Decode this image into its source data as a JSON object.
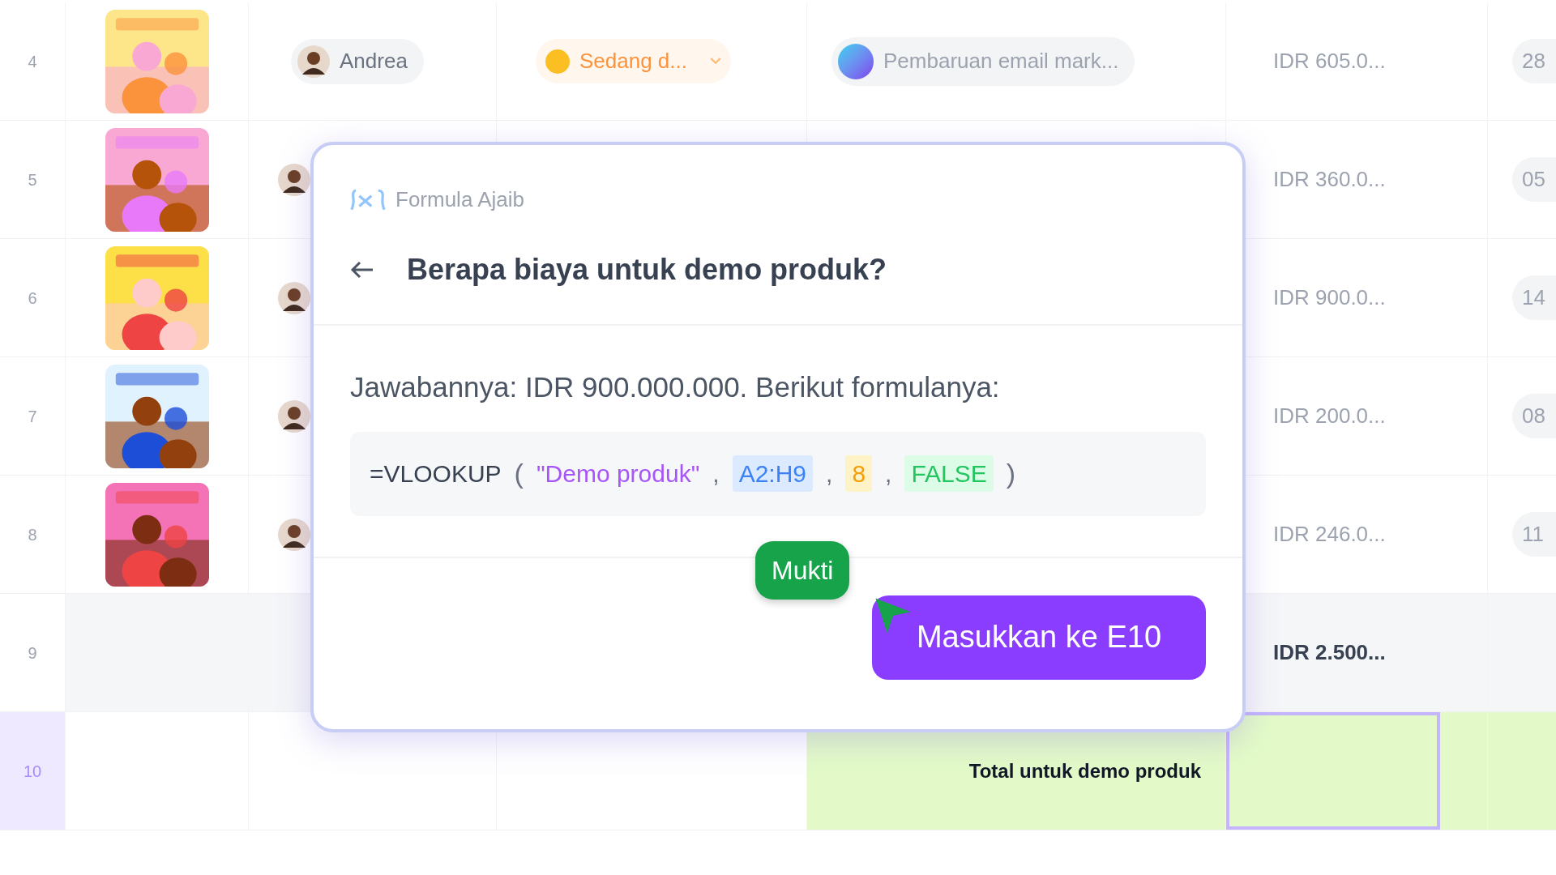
{
  "rows": [
    {
      "number": "4",
      "selected": false,
      "kind": "item",
      "person": {
        "kind": "chip",
        "name": "Andrea"
      },
      "status": {
        "label": "Sedang d..."
      },
      "project": {
        "label": "Pembaruan email mark..."
      },
      "cost": "IDR 605.0...",
      "date": "28"
    },
    {
      "number": "5",
      "selected": false,
      "kind": "item",
      "person": {
        "kind": "avatar"
      },
      "cost": "IDR 360.0...",
      "date": "05"
    },
    {
      "number": "6",
      "selected": false,
      "kind": "item",
      "person": {
        "kind": "avatar"
      },
      "cost": "IDR 900.0...",
      "date": "14"
    },
    {
      "number": "7",
      "selected": false,
      "kind": "item",
      "person": {
        "kind": "avatar"
      },
      "cost": "IDR 200.0...",
      "date": "08"
    },
    {
      "number": "8",
      "selected": false,
      "kind": "item",
      "person": {
        "kind": "avatar"
      },
      "cost": "IDR 246.0...",
      "date": "11"
    },
    {
      "number": "9",
      "selected": false,
      "kind": "subtotal",
      "cost": "IDR 2.500..."
    },
    {
      "number": "10",
      "selected": true,
      "kind": "total",
      "label": "Total untuk demo produk"
    }
  ],
  "dialog": {
    "title": "Formula Ajaib",
    "question": "Berapa biaya untuk demo produk?",
    "answer": "Jawabannya: IDR 900.000.000. Berikut formulanya:",
    "formula": [
      {
        "text": "=VLOOKUP",
        "kind": "function"
      },
      {
        "text": "(",
        "kind": "paren"
      },
      {
        "text": "\"Demo produk\"",
        "kind": "string"
      },
      {
        "text": ",",
        "kind": "comma"
      },
      {
        "text": "A2:H9",
        "kind": "range"
      },
      {
        "text": ",",
        "kind": "comma"
      },
      {
        "text": "8",
        "kind": "number"
      },
      {
        "text": ",",
        "kind": "comma"
      },
      {
        "text": "FALSE",
        "kind": "boolean"
      },
      {
        "text": ")",
        "kind": "paren"
      }
    ],
    "button": "Masukkan ke E10"
  },
  "cursor": {
    "name": "Mukti",
    "color": "#16a34a"
  }
}
